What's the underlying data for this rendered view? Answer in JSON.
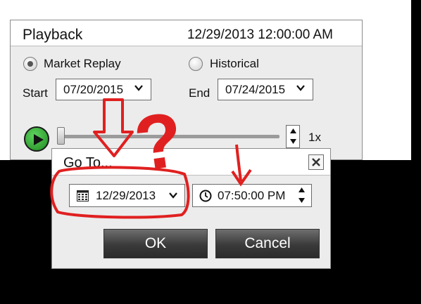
{
  "playback": {
    "title": "Playback",
    "datetime": "12/29/2013 12:00:00 AM",
    "mode_market_replay": "Market Replay",
    "mode_historical": "Historical",
    "selected_mode": "Market Replay",
    "start_label": "Start",
    "start_date": "07/20/2015",
    "end_label": "End",
    "end_date": "07/24/2015",
    "speed": "1x",
    "slider_position": 0
  },
  "goto": {
    "title": "Go To...",
    "date": "12/29/2013",
    "time": "07:50:00 PM",
    "ok_label": "OK",
    "cancel_label": "Cancel"
  },
  "annotations": {
    "question_mark": "?",
    "color": "#e02020"
  },
  "icons": {
    "play": "play-icon",
    "close": "close-icon",
    "calendar": "calendar-icon",
    "clock": "clock-icon",
    "chevron": "chevron-down-icon"
  }
}
